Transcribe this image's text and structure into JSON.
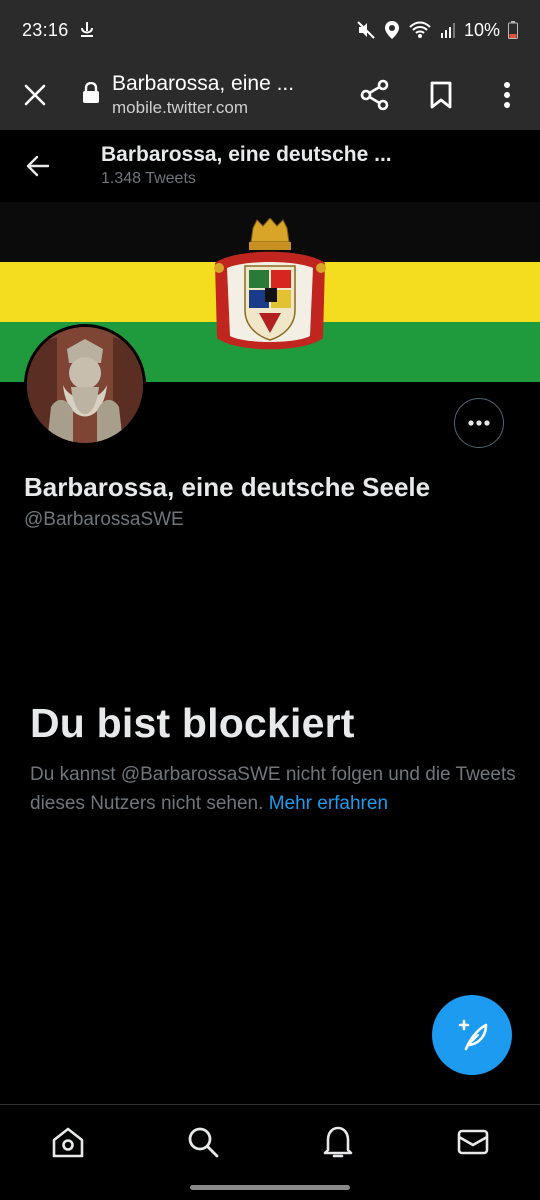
{
  "status_bar": {
    "time": "23:16",
    "battery": "10%"
  },
  "custom_tab": {
    "title": "Barbarossa, eine ...",
    "url": "mobile.twitter.com"
  },
  "header": {
    "name": "Barbarossa, eine deutsche ...",
    "tweet_count": "1.348 Tweets"
  },
  "profile": {
    "display_name": "Barbarossa, eine deutsche Seele",
    "handle": "@BarbarossaSWE",
    "banner_colors": [
      "#0b0b0b",
      "#f4dd1e",
      "#1f9a3c"
    ]
  },
  "blocked": {
    "title": "Du bist blockiert",
    "text": "Du kannst @BarbarossaSWE nicht folgen und die Tweets dieses Nutzers nicht sehen.",
    "link": "Mehr erfahren"
  },
  "bottom_nav": [
    "home-icon",
    "search-icon",
    "notifications-icon",
    "messages-icon"
  ],
  "accent": "#1d9bf0"
}
